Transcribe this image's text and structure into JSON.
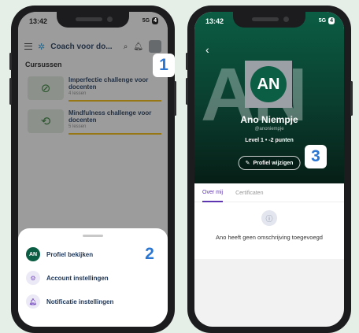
{
  "phone1": {
    "status": {
      "time": "13:42",
      "net": "5G",
      "battery": "4"
    },
    "appbar": {
      "logo": "✲",
      "title": "Coach voor do...",
      "search": "⌕",
      "bell": "🔔︎"
    },
    "section": {
      "title": "Cursussen",
      "filter": "⊽"
    },
    "courses": [
      {
        "title": "Imperfectie challenge voor docenten",
        "lessons": "4 lessen",
        "icon": "⊘"
      },
      {
        "title": "Mindfulness challenge voor docenten",
        "lessons": "5 lessen",
        "icon": "⟲"
      }
    ],
    "sheet": [
      {
        "icon": "AN",
        "label": "Profiel bekijken"
      },
      {
        "icon": "⚙",
        "label": "Account instellingen"
      },
      {
        "icon": "🔔︎",
        "label": "Notificatie instellingen"
      }
    ]
  },
  "phone2": {
    "status": {
      "time": "13:42",
      "net": "5G",
      "battery": "4"
    },
    "back": "‹",
    "avatar_initials": "AN",
    "bg_initials": "AN",
    "name": "Ano Niempje",
    "handle": "@anoniempje",
    "level": "Level 1  •  -2 punten",
    "edit_icon": "✎",
    "edit_label": "Profiel wijzigen",
    "tabs": [
      "Over mij",
      "Certificaten"
    ],
    "empty_icon": "ⓘ",
    "empty_text": "Ano heeft geen omschrijving toegevoegd"
  },
  "callouts": [
    "1",
    "2",
    "3"
  ]
}
